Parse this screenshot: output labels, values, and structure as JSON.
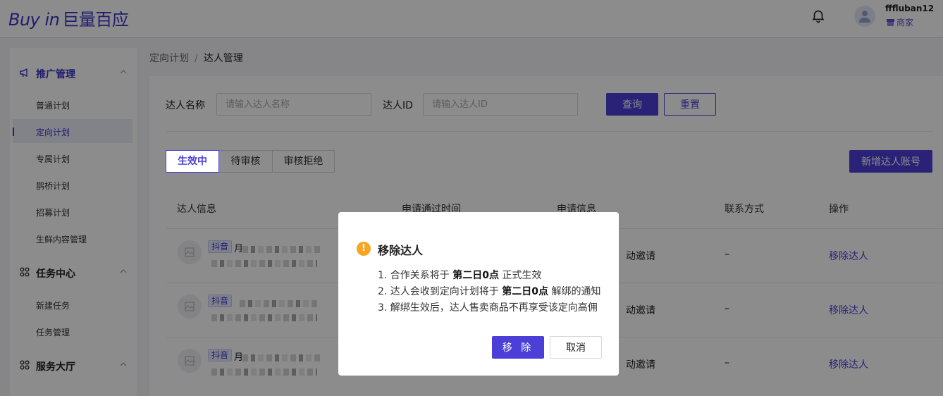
{
  "header": {
    "logo_text": "Buy in",
    "logo_cn": "巨量百应",
    "icons": {
      "notification": "bell-icon",
      "avatar": "user-avatar-icon",
      "role": "shop-icon"
    },
    "user_name": "fffluban12",
    "user_role": "商家"
  },
  "sidebar": {
    "groups": [
      {
        "label": "推广管理",
        "icon": "megaphone-icon",
        "expanded": true
      },
      {
        "label": "任务中心",
        "icon": "grid-icon",
        "expanded": true
      },
      {
        "label": "服务大厅",
        "icon": "grid-icon",
        "expanded": true
      }
    ],
    "items": [
      {
        "label": "普通计划"
      },
      {
        "label": "定向计划",
        "selected": true
      },
      {
        "label": "专属计划"
      },
      {
        "label": "鹊桥计划"
      },
      {
        "label": "招募计划"
      },
      {
        "label": "生鲜内容管理"
      },
      {
        "label": "新建任务"
      },
      {
        "label": "任务管理"
      }
    ]
  },
  "breadcrumb": {
    "parent": "定向计划",
    "separator": "/",
    "current": "达人管理"
  },
  "filters": {
    "name_label": "达人名称",
    "name_placeholder": "请输入达人名称",
    "id_label": "达人ID",
    "id_placeholder": "请输入达人ID",
    "query_button": "查询",
    "reset_button": "重置"
  },
  "tabs": [
    {
      "label": "生效中",
      "active": true
    },
    {
      "label": "待审核"
    },
    {
      "label": "审核拒绝"
    }
  ],
  "add_button": "新增达人账号",
  "table": {
    "columns": [
      "达人信息",
      "申请通过时间",
      "申请信息",
      "联系方式",
      "操作"
    ],
    "rows": [
      {
        "platform": "抖音",
        "name_initial": "月",
        "apply_info": "动邀请",
        "contact": "–",
        "action": "移除达人"
      },
      {
        "platform": "抖音",
        "name_initial": "",
        "apply_info": "动邀请",
        "contact": "–",
        "action": "移除达人"
      },
      {
        "platform": "抖音",
        "name_initial": "月",
        "apply_info": "动邀请",
        "contact": "–",
        "action": "移除达人"
      }
    ]
  },
  "modal": {
    "icon": "warning-icon",
    "title": "移除达人",
    "lines": [
      {
        "prefix": "1. 合作关系将于 ",
        "bold": "第二日0点",
        "suffix": " 正式生效"
      },
      {
        "prefix": "2. 达人会收到定向计划将于 ",
        "bold": "第二日0点",
        "suffix": " 解绑的通知"
      },
      {
        "prefix": "3. 解绑生效后，达人售卖商品不再享受该定向高佣",
        "bold": "",
        "suffix": ""
      }
    ],
    "confirm_button": "移 除",
    "cancel_button": "取消"
  },
  "colors": {
    "brand": "#4b3fd8",
    "warning": "#f5a623",
    "overlay": "rgba(0,0,0,0.45)"
  }
}
